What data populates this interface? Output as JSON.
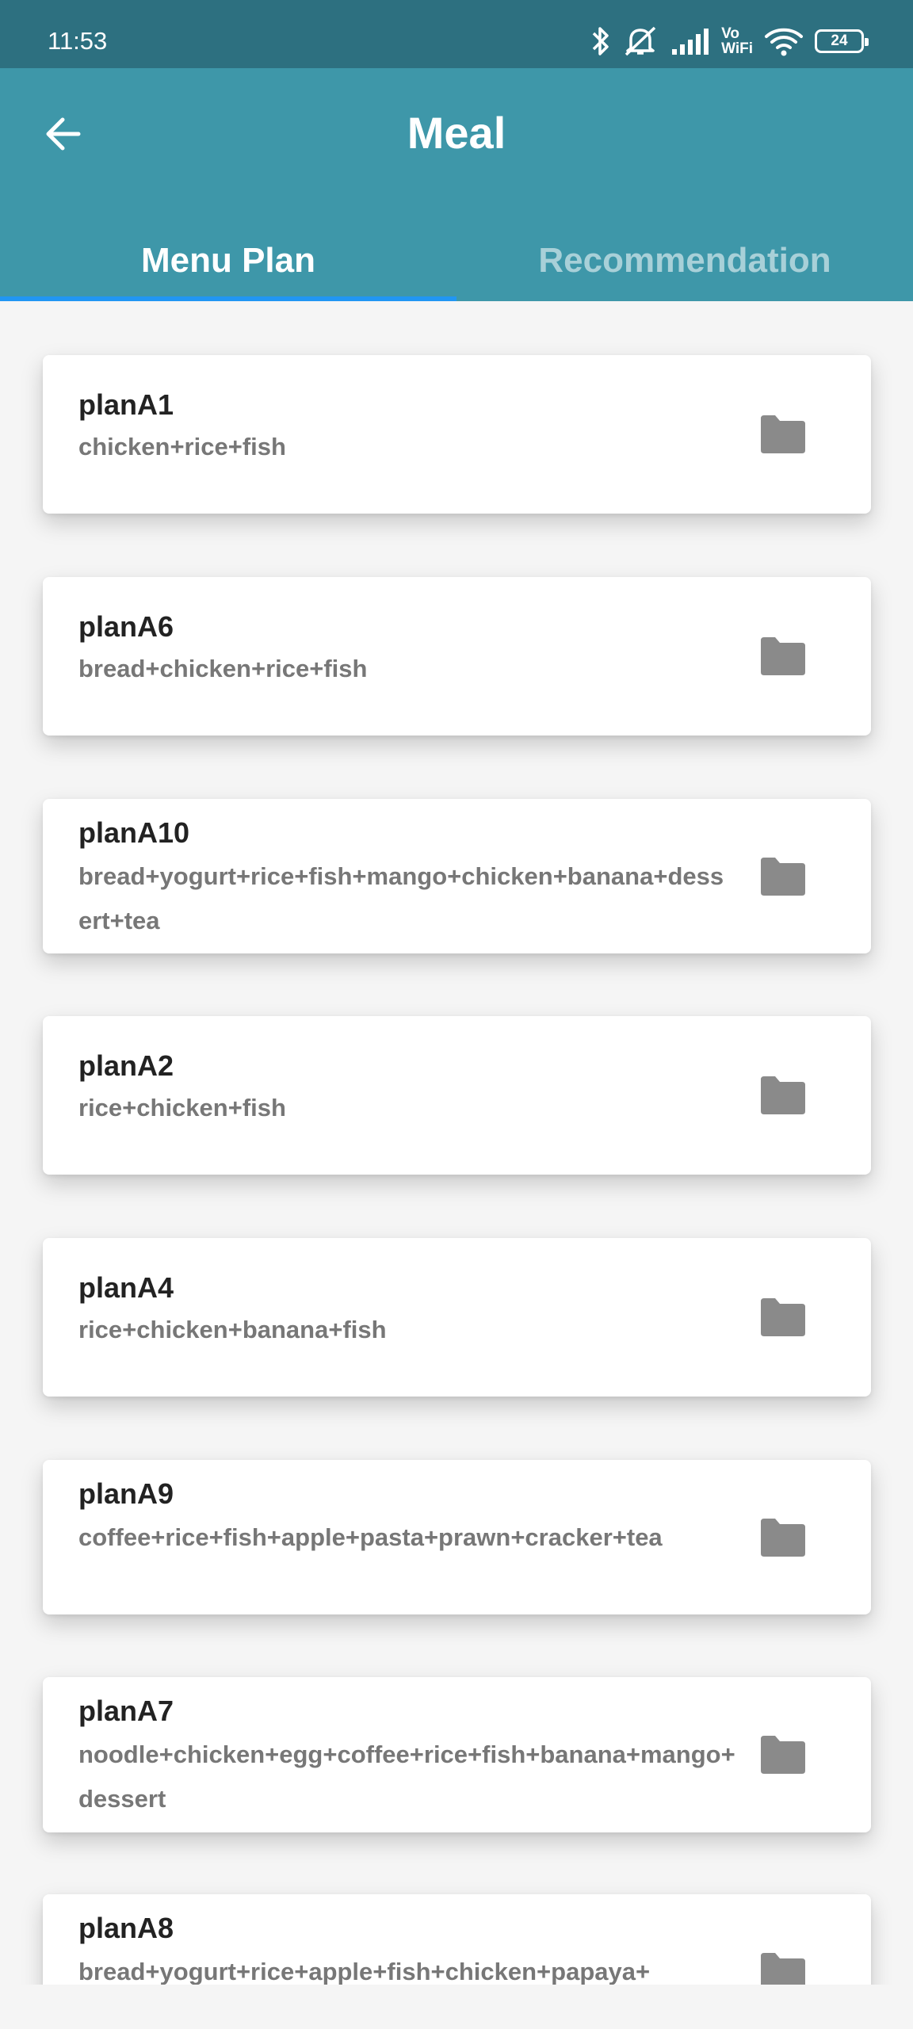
{
  "status_bar": {
    "time": "11:53",
    "vowifi_top": "Vo",
    "vowifi_bottom": "WiFi",
    "battery": "24",
    "icons": [
      "bluetooth-icon",
      "mute-icon",
      "signal-icon",
      "vowifi-icon",
      "wifi-icon",
      "battery-icon"
    ]
  },
  "app_bar": {
    "title": "Meal",
    "back_icon": "arrow-left-icon"
  },
  "tabs": [
    {
      "label": "Menu Plan",
      "active": true
    },
    {
      "label": "Recommendation",
      "active": false
    }
  ],
  "plans": [
    {
      "name": "planA1",
      "items": "chicken+rice+fish",
      "icon": "folder-icon"
    },
    {
      "name": "planA6",
      "items": "bread+chicken+rice+fish",
      "icon": "folder-icon"
    },
    {
      "name": "planA10",
      "items": "bread+yogurt+rice+fish+mango+chicken+banana+dessert+tea",
      "icon": "folder-icon"
    },
    {
      "name": "planA2",
      "items": "rice+chicken+fish",
      "icon": "folder-icon"
    },
    {
      "name": "planA4",
      "items": "rice+chicken+banana+fish",
      "icon": "folder-icon"
    },
    {
      "name": "planA9",
      "items": "coffee+rice+fish+apple+pasta+prawn+cracker+tea",
      "icon": "folder-icon"
    },
    {
      "name": "planA7",
      "items": "noodle+chicken+egg+coffee+rice+fish+banana+mango+dessert",
      "icon": "folder-icon"
    },
    {
      "name": "planA8",
      "items": "bread+yogurt+rice+apple+fish+chicken+papaya+",
      "icon": "folder-icon"
    }
  ],
  "colors": {
    "status_bar": "#2d7080",
    "app_bar": "#3e97a9",
    "tab_indicator": "#2196f3",
    "background": "#f5f5f5",
    "folder_icon": "#8a8a8a"
  }
}
